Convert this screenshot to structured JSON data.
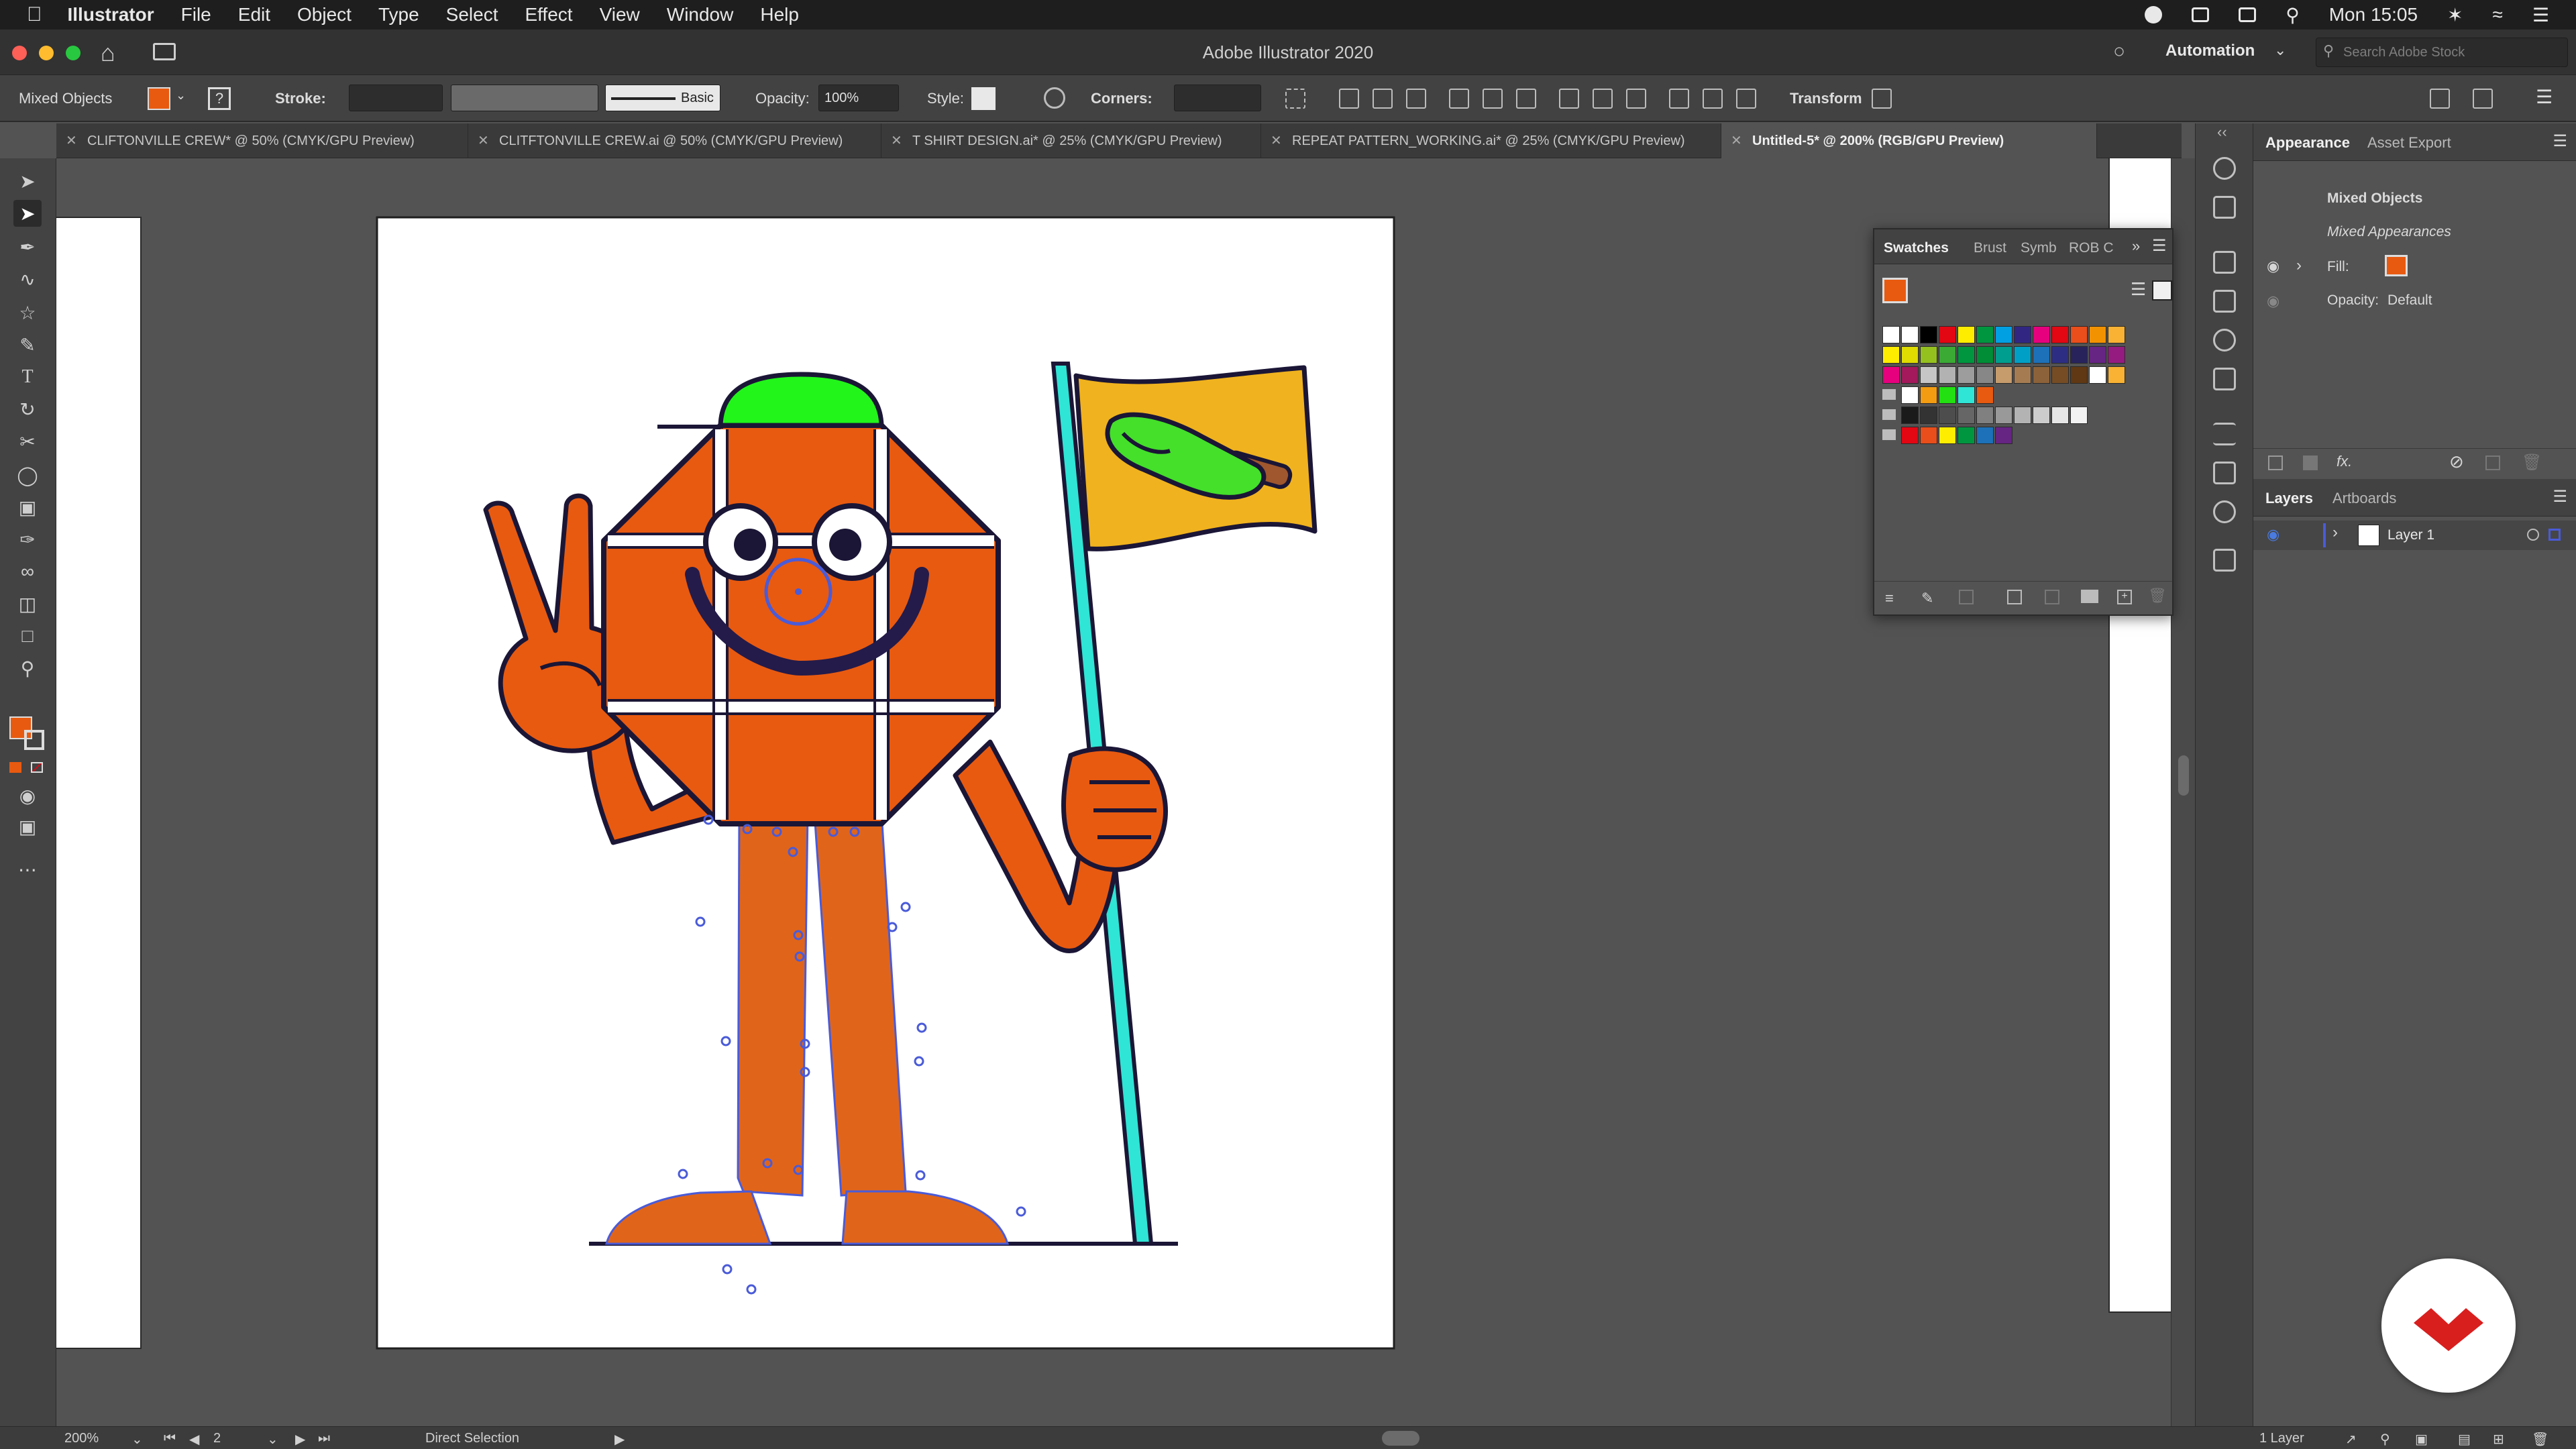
{
  "menubar": {
    "app_name": "Illustrator",
    "items": [
      "File",
      "Edit",
      "Object",
      "Type",
      "Select",
      "Effect",
      "View",
      "Window",
      "Help"
    ],
    "clock": "Mon 15:05"
  },
  "window": {
    "title": "Adobe Illustrator 2020"
  },
  "workspace": {
    "name": "Automation",
    "search_placeholder": "Search Adobe Stock"
  },
  "controlbar": {
    "selection": "Mixed Objects",
    "stroke_label": "Stroke:",
    "brush_label": "Basic",
    "opacity_label": "Opacity:",
    "opacity_value": "100%",
    "style_label": "Style:",
    "corners_label": "Corners:",
    "transform_label": "Transform"
  },
  "tabs": [
    {
      "label": "CLIFTONVILLE CREW* @ 50% (CMYK/GPU Preview)"
    },
    {
      "label": "CLITFTONVILLE CREW.ai @ 50% (CMYK/GPU Preview)"
    },
    {
      "label": "T SHIRT DESIGN.ai* @ 25% (CMYK/GPU Preview)"
    },
    {
      "label": "REPEAT PATTERN_WORKING.ai* @ 25% (CMYK/GPU Preview)"
    },
    {
      "label": "Untitled-5* @ 200% (RGB/GPU Preview)"
    }
  ],
  "swatches_panel": {
    "tabs": [
      "Swatches",
      "Brust",
      "Symb",
      "ROB C"
    ],
    "colors_row1": [
      "#ffffff",
      "#ffffff",
      "#000000",
      "#e30613",
      "#ffed00",
      "#009640",
      "#00a0e3",
      "#312783",
      "#e6007e",
      "#e30613",
      "#e94e1b",
      "#f39200",
      "#f9b233"
    ],
    "colors_row2": [
      "#ffed00",
      "#dedc00",
      "#95c11f",
      "#3aaa35",
      "#00963f",
      "#008d36",
      "#009e8e",
      "#00a0c6",
      "#1d71b8",
      "#2d2e83",
      "#29235c",
      "#662483",
      "#951b81"
    ],
    "colors_row3": [
      "#e6007e",
      "#a3195b",
      "#c6c6c6",
      "#b2b2b2",
      "#9d9d9d",
      "#878787",
      "#c69c6d",
      "#a57c52",
      "#8b6239",
      "#754c24",
      "#603813",
      "#ffffff",
      "#f9b233"
    ],
    "colors_row4": [
      "#ffffff",
      "#f39c12",
      "#22e011",
      "#2fe5d5",
      "#e85a10"
    ],
    "colors_row5": [
      "#1a1a1a",
      "#333333",
      "#4d4d4d",
      "#666666",
      "#808080",
      "#999999",
      "#b3b3b3",
      "#cccccc",
      "#e6e6e6",
      "#f2f2f2"
    ],
    "colors_row6": [
      "#e30613",
      "#e94e1b",
      "#ffed00",
      "#009640",
      "#1d71b8",
      "#662483"
    ]
  },
  "appearance_panel": {
    "tabs": [
      "Appearance",
      "Asset Export"
    ],
    "title": "Mixed Objects",
    "subtitle": "Mixed Appearances",
    "fill_label": "Fill:",
    "opacity_label": "Opacity:",
    "opacity_value": "Default",
    "fill_color": "#e85a10"
  },
  "layers_panel": {
    "tabs": [
      "Layers",
      "Artboards"
    ],
    "layer_name": "Layer 1",
    "count_label": "1 Layer"
  },
  "statusbar": {
    "zoom": "200%",
    "artboard": "2",
    "tool": "Direct Selection"
  },
  "colors": {
    "orange": "#e85a10",
    "leg_orange": "#e0651a",
    "cap_green": "#22f51a",
    "pole_cyan": "#2fe5d5",
    "flag_yellow": "#f0b21e",
    "outline": "#1b1636",
    "selection_blue": "#4a5bd8",
    "popsicle_green": "#44e02a",
    "popsicle_stick": "#a0572d"
  }
}
